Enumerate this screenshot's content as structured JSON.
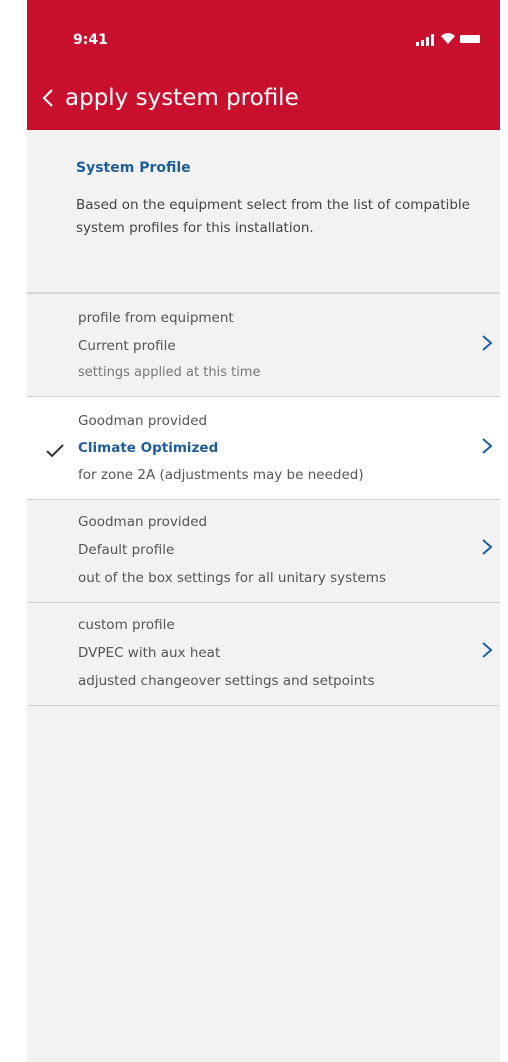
{
  "status_bar": {
    "time": "9:41",
    "signal_icon": "signal-icon",
    "wifi_icon": "wifi-icon",
    "battery_icon": "battery-icon"
  },
  "header": {
    "back_icon": "chevron-left-icon",
    "title": "apply system profile",
    "color": "#c8102e"
  },
  "intro": {
    "title": "System  Profile",
    "description": "Based on the equipment select from the list of compatible system profiles for this installation."
  },
  "profiles": [
    {
      "source": "profile from equipment",
      "name": "Current profile",
      "note": "settings applied at this time",
      "selected": false
    },
    {
      "source": "Goodman provided",
      "name": "Climate Optimized",
      "note": "for zone 2A (adjustments may be needed)",
      "selected": true
    },
    {
      "source": "Goodman provided",
      "name": "Default profile",
      "note": "out of the box settings for all unitary systems",
      "selected": false
    },
    {
      "source": "custom profile",
      "name": "DVPEC with aux heat",
      "note": "adjusted changeover settings and setpoints",
      "selected": false
    }
  ],
  "colors": {
    "accent": "#1f5d9a",
    "background": "#f2f2f2",
    "selected_row": "#ffffff"
  }
}
